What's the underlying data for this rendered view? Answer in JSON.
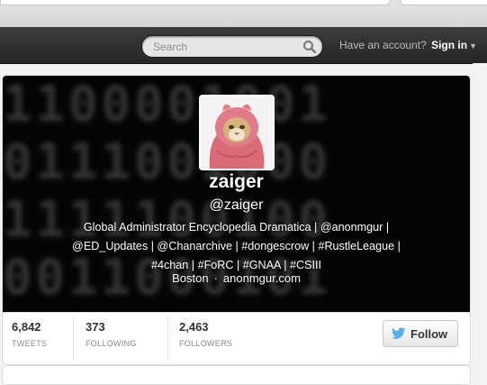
{
  "topbar": {
    "search_placeholder": "Search",
    "account_prompt": "Have an account?",
    "sign_in_label": "Sign in",
    "caret_icon": "chevron-down-icon"
  },
  "profile": {
    "name": "zaiger",
    "handle": "@zaiger",
    "bio_lines": [
      "Global Administrator Encyclopedia Dramatica | @anonmgur |",
      "@ED_Updates | @Chanarchive | #dongescrow | #RustleLeague |",
      "#4chan | #FoRC | #GNAA | #CSIII"
    ],
    "location": "Boston",
    "separator": "·",
    "website": "anonmgur.com",
    "avatar_icon": "cat-in-pink-hood-avatar"
  },
  "stats": {
    "tweets": {
      "value": "6,842",
      "label": "TWEETS"
    },
    "following": {
      "value": "373",
      "label": "FOLLOWING"
    },
    "followers": {
      "value": "2,463",
      "label": "FOLLOWERS"
    }
  },
  "actions": {
    "follow_label": "Follow",
    "follow_icon": "twitter-bird-icon"
  },
  "colors": {
    "topbar_bg": "#2e2e2e",
    "hero_bg": "#050505",
    "bird_blue": "#55acee"
  }
}
